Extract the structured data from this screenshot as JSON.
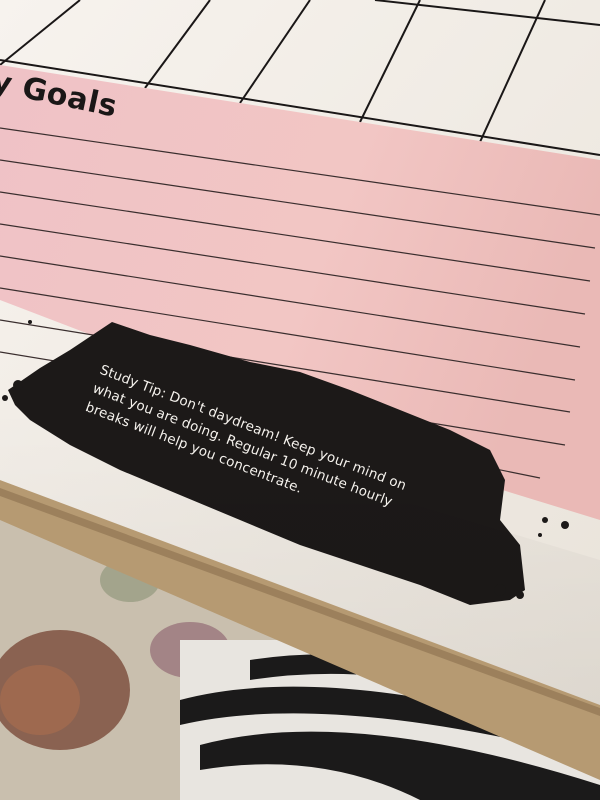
{
  "heading": {
    "text": "y Goals"
  },
  "study_tip": {
    "lines": [
      "Study Tip: Don't daydream! Keep your mind on",
      "what you are doing. Regular 10 minute hourly",
      "breaks will help you concentrate."
    ]
  },
  "colors": {
    "paper": "#f3efe9",
    "pink_panel": "#f1c3c2",
    "ink": "#1a1717",
    "tip_text": "#f4f1ec",
    "pillow": "#d8cfc0"
  },
  "icons": {
    "brush_stroke": "black-paint-brush-stroke"
  }
}
